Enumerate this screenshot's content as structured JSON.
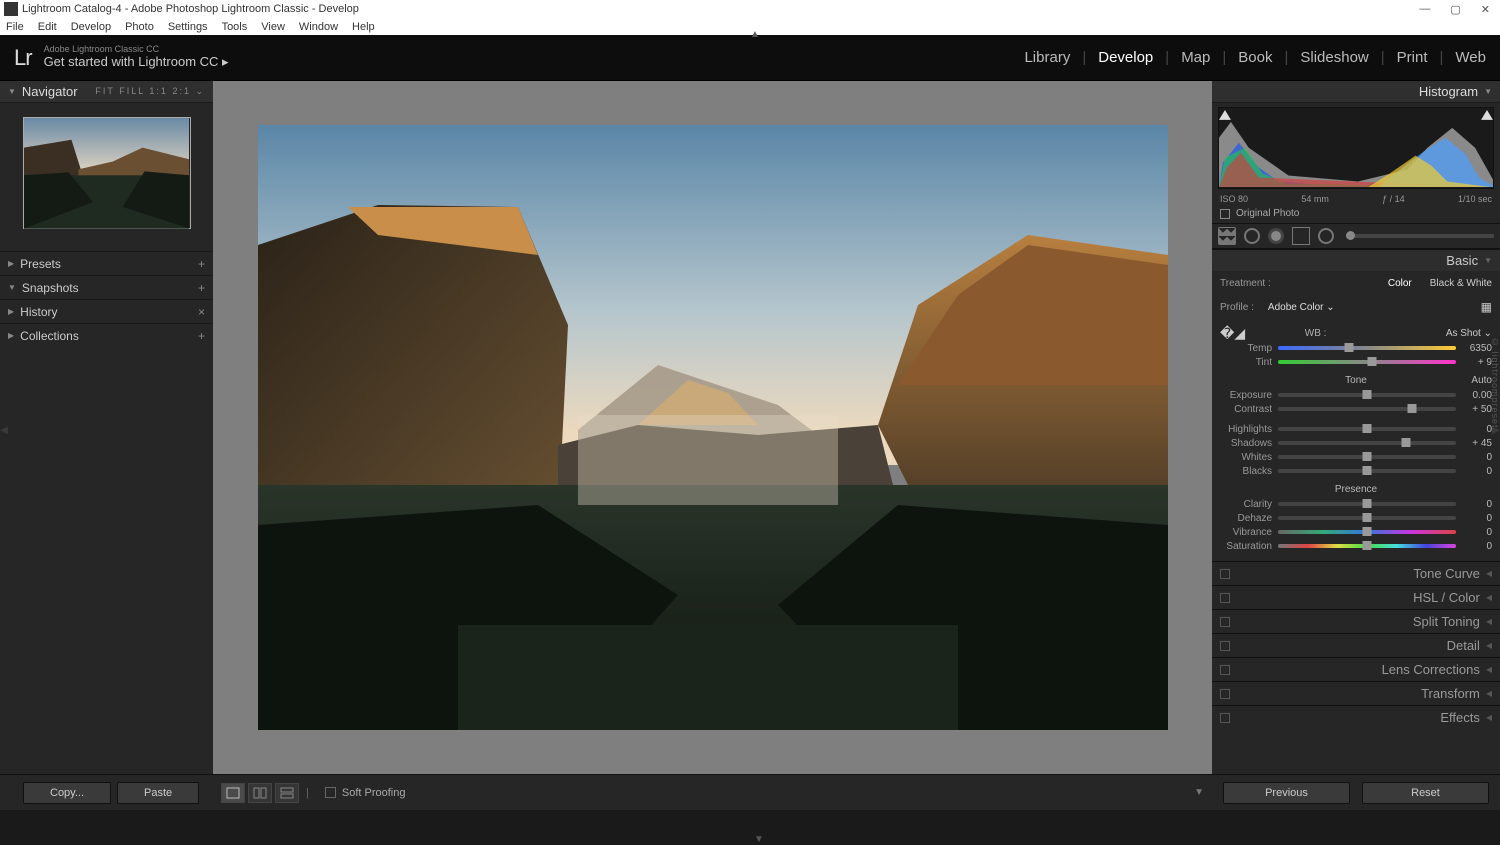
{
  "title": "Lightroom Catalog-4 - Adobe Photoshop Lightroom Classic - Develop",
  "menu": [
    "File",
    "Edit",
    "Develop",
    "Photo",
    "Settings",
    "Tools",
    "View",
    "Window",
    "Help"
  ],
  "header": {
    "logo": "Lr",
    "sub": "Adobe Lightroom Classic CC",
    "main": "Get started with Lightroom CC  ▸"
  },
  "modules": [
    "Library",
    "Develop",
    "Map",
    "Book",
    "Slideshow",
    "Print",
    "Web"
  ],
  "active_module": "Develop",
  "left": {
    "navigator": "Navigator",
    "nav_modes": "FIT   FILL   1:1   2:1  ⌄",
    "sections": [
      {
        "name": "Presets",
        "action": "+"
      },
      {
        "name": "Snapshots",
        "action": "+"
      },
      {
        "name": "History",
        "action": "×"
      },
      {
        "name": "Collections",
        "action": "+"
      }
    ]
  },
  "histogram": {
    "title": "Histogram",
    "labels": [
      "ISO 80",
      "54 mm",
      "ƒ / 14",
      "1/10 sec"
    ],
    "orig": "Original Photo"
  },
  "basic": {
    "title": "Basic",
    "treatment_lbl": "Treatment :",
    "treatment_opts": [
      "Color",
      "Black & White"
    ],
    "profile_lbl": "Profile :",
    "profile_val": "Adobe Color  ⌄",
    "wb_lbl": "WB :",
    "wb_val": "As Shot ⌄",
    "tone": "Tone",
    "auto": "Auto",
    "presence": "Presence",
    "sliders": {
      "temp": {
        "lbl": "Temp",
        "val": "6350",
        "pos": 40
      },
      "tint": {
        "lbl": "Tint",
        "val": "+ 9",
        "pos": 53
      },
      "exposure": {
        "lbl": "Exposure",
        "val": "0.00",
        "pos": 50
      },
      "contrast": {
        "lbl": "Contrast",
        "val": "+ 50",
        "pos": 75
      },
      "highlights": {
        "lbl": "Highlights",
        "val": "0",
        "pos": 50
      },
      "shadows": {
        "lbl": "Shadows",
        "val": "+ 45",
        "pos": 72
      },
      "whites": {
        "lbl": "Whites",
        "val": "0",
        "pos": 50
      },
      "blacks": {
        "lbl": "Blacks",
        "val": "0",
        "pos": 50
      },
      "clarity": {
        "lbl": "Clarity",
        "val": "0",
        "pos": 50
      },
      "dehaze": {
        "lbl": "Dehaze",
        "val": "0",
        "pos": 50
      },
      "vibrance": {
        "lbl": "Vibrance",
        "val": "0",
        "pos": 50
      },
      "saturation": {
        "lbl": "Saturation",
        "val": "0",
        "pos": 50
      }
    }
  },
  "collapsed_panels": [
    "Tone Curve",
    "HSL / Color",
    "Split Toning",
    "Detail",
    "Lens Corrections",
    "Transform",
    "Effects"
  ],
  "bottom": {
    "copy": "Copy...",
    "paste": "Paste",
    "soft": "Soft Proofing",
    "prev": "Previous",
    "reset": "Reset"
  },
  "watermark": "© lightroompresets"
}
